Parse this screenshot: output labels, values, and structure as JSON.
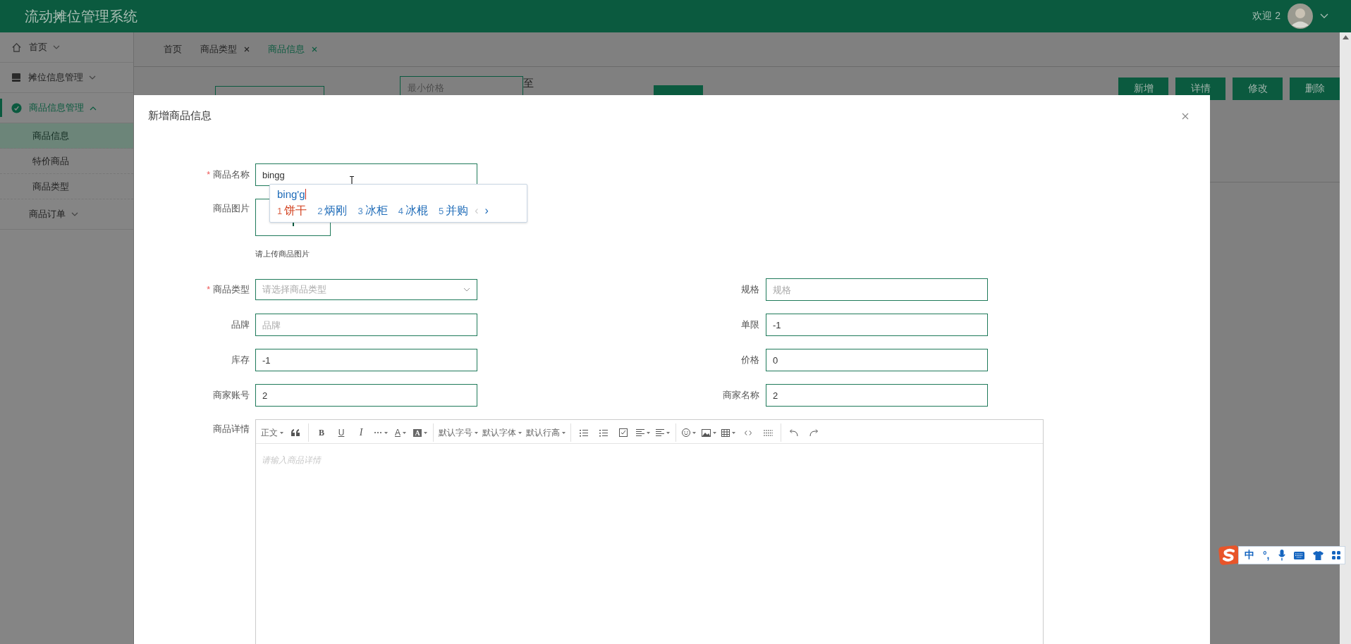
{
  "header": {
    "title": "流动摊位管理系统",
    "welcome": "欢迎 2"
  },
  "sidebar": {
    "items": [
      {
        "label": "首页",
        "selected": false,
        "expanded": false
      },
      {
        "label": "摊位信息管理",
        "selected": false,
        "expanded": false
      },
      {
        "label": "商品信息管理",
        "selected": true,
        "expanded": true,
        "children": [
          {
            "label": "商品信息",
            "selected": true
          },
          {
            "label": "特价商品",
            "selected": false
          },
          {
            "label": "商品类型",
            "selected": false
          }
        ]
      },
      {
        "label": "商品订单",
        "selected": false,
        "expanded": false
      }
    ]
  },
  "tabs": [
    {
      "label": "首页",
      "selected": false,
      "closable": false
    },
    {
      "label": "商品类型",
      "selected": false,
      "closable": true
    },
    {
      "label": "商品信息",
      "selected": true,
      "closable": true
    }
  ],
  "search": {
    "price_min_placeholder": "最小价格",
    "range_separator": "至"
  },
  "actions": [
    "新增",
    "详情",
    "修改",
    "删除"
  ],
  "dialog": {
    "title": "新增商品信息",
    "required_mark": "*",
    "rows": [
      [
        {
          "kind": "text",
          "label": "商品名称",
          "required": true,
          "value": "bingg"
        }
      ],
      [
        {
          "kind": "upload",
          "label": "商品图片",
          "required": false,
          "hint": "请上传商品图片"
        }
      ],
      [
        {
          "kind": "select",
          "label": "商品类型",
          "required": true,
          "placeholder": "请选择商品类型"
        },
        {
          "kind": "text",
          "label": "规格",
          "required": false,
          "placeholder": "规格"
        }
      ],
      [
        {
          "kind": "text",
          "label": "品牌",
          "required": false,
          "placeholder": "品牌"
        },
        {
          "kind": "text",
          "label": "单限",
          "required": false,
          "value": "-1"
        }
      ],
      [
        {
          "kind": "text",
          "label": "库存",
          "required": false,
          "value": "-1"
        },
        {
          "kind": "text",
          "label": "价格",
          "required": false,
          "value": "0"
        }
      ],
      [
        {
          "kind": "text",
          "label": "商家账号",
          "required": false,
          "value": "2"
        },
        {
          "kind": "text",
          "label": "商家名称",
          "required": false,
          "value": "2"
        }
      ],
      [
        {
          "kind": "editor",
          "label": "商品详情",
          "required": false,
          "placeholder": "请输入商品详情",
          "toolbar": [
            [
              {
                "kind": "text",
                "label": "正文",
                "dropdown": true
              },
              {
                "kind": "quote",
                "dropdown": false
              }
            ],
            [
              {
                "kind": "bold",
                "label": "B",
                "dropdown": false
              },
              {
                "kind": "underline",
                "label": "U",
                "dropdown": false
              },
              {
                "kind": "italic",
                "label": "I",
                "dropdown": false
              },
              {
                "kind": "more",
                "dropdown": true
              },
              {
                "kind": "font-color",
                "label": "A",
                "dropdown": true
              },
              {
                "kind": "highlight",
                "label": "A",
                "dropdown": true
              }
            ],
            [
              {
                "kind": "text",
                "label": "默认字号",
                "dropdown": true
              },
              {
                "kind": "text",
                "label": "默认字体",
                "dropdown": true
              },
              {
                "kind": "text",
                "label": "默认行高",
                "dropdown": true
              }
            ],
            [
              {
                "kind": "bullet-list",
                "dropdown": false
              },
              {
                "kind": "numbered-list",
                "dropdown": false
              },
              {
                "kind": "todo",
                "dropdown": false
              },
              {
                "kind": "align",
                "dropdown": true
              },
              {
                "kind": "indent",
                "dropdown": true
              }
            ],
            [
              {
                "kind": "emoji",
                "dropdown": true
              },
              {
                "kind": "image",
                "dropdown": true
              },
              {
                "kind": "table",
                "dropdown": true
              },
              {
                "kind": "code",
                "dropdown": false
              },
              {
                "kind": "divider",
                "dropdown": false
              }
            ],
            [
              {
                "kind": "undo",
                "dropdown": false
              },
              {
                "kind": "redo",
                "dropdown": false
              }
            ]
          ]
        }
      ]
    ]
  },
  "ime": {
    "composition": "bing'g",
    "candidates": [
      {
        "number": "1",
        "text": "饼干",
        "selected": true
      },
      {
        "number": "2",
        "text": "炳刚",
        "selected": false
      },
      {
        "number": "3",
        "text": "冰柜",
        "selected": false
      },
      {
        "number": "4",
        "text": "冰棍",
        "selected": false
      },
      {
        "number": "5",
        "text": "并购",
        "selected": false
      }
    ],
    "prev_page": {
      "glyph": "‹",
      "disabled": true
    },
    "next_page": {
      "glyph": "›",
      "disabled": false
    }
  },
  "ime_bar": {
    "mode": "中",
    "punctuation": "°,"
  }
}
